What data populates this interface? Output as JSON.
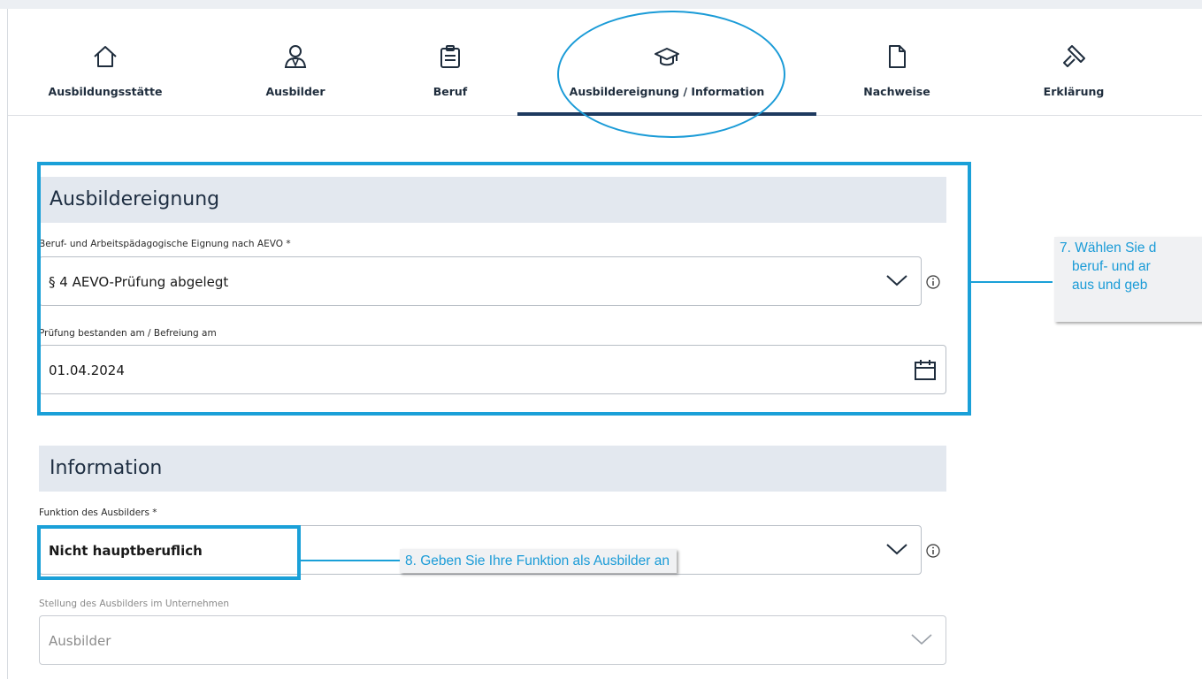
{
  "tabs": [
    {
      "label": "Ausbildungsstätte",
      "icon": "house-icon"
    },
    {
      "label": "Ausbilder",
      "icon": "person-icon"
    },
    {
      "label": "Beruf",
      "icon": "clipboard-icon"
    },
    {
      "label": "Ausbildereignung / Information",
      "icon": "graduation-cap-icon",
      "active": true
    },
    {
      "label": "Nachweise",
      "icon": "document-icon"
    },
    {
      "label": "Erklärung",
      "icon": "gavel-icon"
    }
  ],
  "sections": {
    "eignung": {
      "title": "Ausbildereignung",
      "aevo_label": "Beruf- und Arbeitspädagogische Eignung nach AEVO  *",
      "aevo_value": "§ 4 AEVO-Prüfung abgelegt",
      "date_label": "Prüfung bestanden am / Befreiung am",
      "date_value": "01.04.2024"
    },
    "information": {
      "title": "Information",
      "funktion_label": "Funktion des Ausbilders  *",
      "funktion_value": "Nicht hauptberuflich",
      "stellung_label": "Stellung des Ausbilders im Unternehmen",
      "stellung_value": "Ausbilder"
    }
  },
  "callouts": {
    "step7_line1": "7. Wählen Sie d",
    "step7_line2": "beruf- und ar",
    "step7_line3": "aus und geb",
    "step8": "8. Geben Sie Ihre Funktion als Ausbilder an"
  },
  "colors": {
    "accent": "#1aa0d8",
    "active_tab_bar": "#1e3a5f",
    "section_bg": "#e3e8ef"
  }
}
